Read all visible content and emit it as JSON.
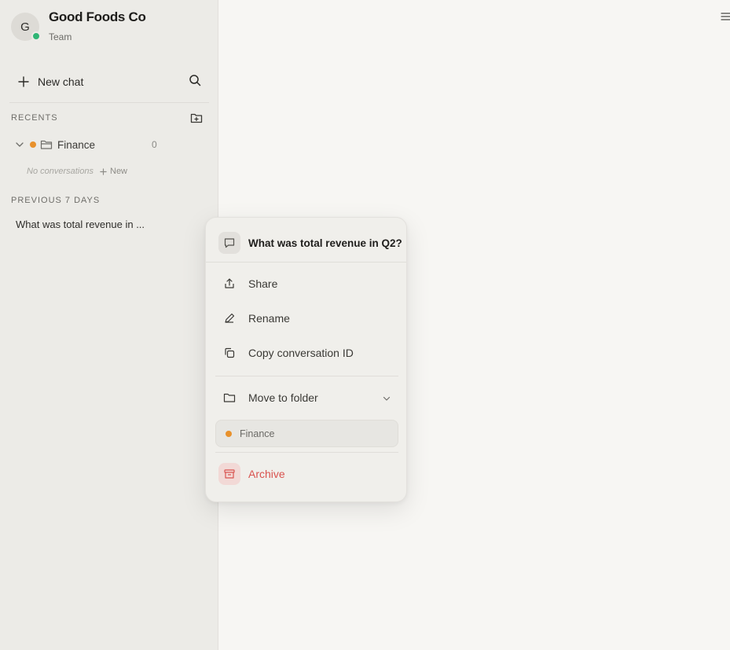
{
  "org": {
    "initial": "G",
    "name": "Good Foods Co",
    "plan": "Team"
  },
  "sidebar": {
    "new_chat_label": "New chat",
    "recents_label": "RECENTS",
    "folders": [
      {
        "name": "Finance",
        "count": "0",
        "color": "#e8912c"
      }
    ],
    "empty_text": "No conversations",
    "new_link_label": "New",
    "previous_label": "PREVIOUS 7 DAYS",
    "conversations": [
      {
        "title": "What was total revenue in ..."
      }
    ]
  },
  "menu": {
    "title": "What was total revenue in Q2?",
    "share_label": "Share",
    "rename_label": "Rename",
    "copy_id_label": "Copy conversation ID",
    "move_label": "Move to folder",
    "folder_option": "Finance",
    "archive_label": "Archive"
  },
  "colors": {
    "accent_orange": "#e8912c",
    "online_green": "#2fb574",
    "danger": "#d9534f"
  },
  "icons": [
    "search-icon",
    "plus-icon",
    "new-folder-icon",
    "chevron-down-icon",
    "folder-icon",
    "chat-bubble-icon",
    "share-icon",
    "pencil-icon",
    "copy-icon",
    "archive-icon",
    "menu-icon"
  ]
}
